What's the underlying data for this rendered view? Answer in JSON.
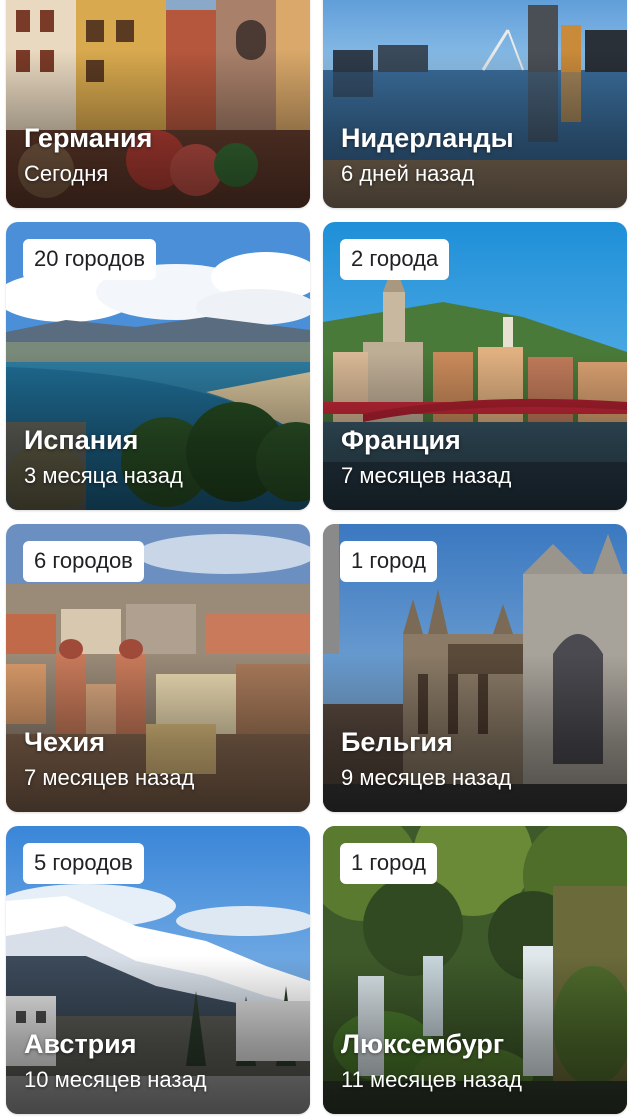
{
  "destinations": [
    {
      "name": "Германия",
      "updated": "Сегодня"
    },
    {
      "name": "Нидерланды",
      "updated": "6 дней назад"
    },
    {
      "name": "Испания",
      "updated": "3 месяца назад",
      "cities": "20 городов"
    },
    {
      "name": "Франция",
      "updated": "7 месяцев назад",
      "cities": "2 города"
    },
    {
      "name": "Чехия",
      "updated": "7 месяцев назад",
      "cities": "6 городов"
    },
    {
      "name": "Бельгия",
      "updated": "9 месяцев назад",
      "cities": "1 город"
    },
    {
      "name": "Австрия",
      "updated": "10 месяцев назад",
      "cities": "5 городов"
    },
    {
      "name": "Люксембург",
      "updated": "11 месяцев назад",
      "cities": "1 город"
    }
  ],
  "accent_color": "#1a73e8"
}
